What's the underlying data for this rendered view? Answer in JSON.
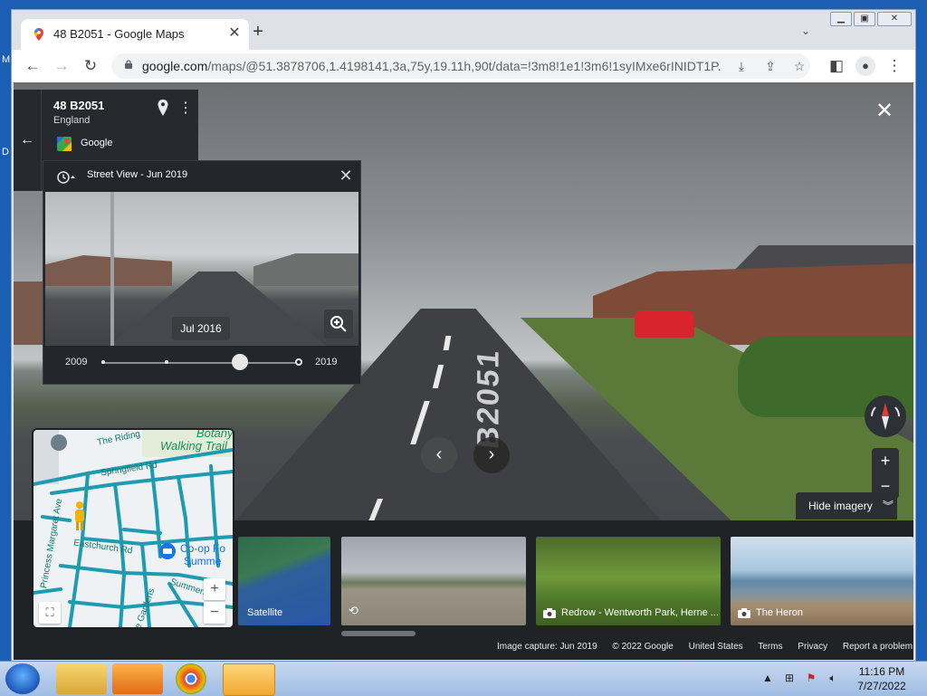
{
  "browser": {
    "tab_title": "48 B2051 - Google Maps",
    "url_host": "google.com",
    "url_path": "/maps/@51.3878706,1.4198141,3a,75y,19.11h,90t/data=!3m8!1e1!3m6!1syIMxe6rINIDT1P..."
  },
  "infocard": {
    "address": "48 B2051",
    "region": "England",
    "provider": "Google"
  },
  "timemachine": {
    "title": "Street View - Jun 2019",
    "preview_date": "Jul 2016",
    "year_min": "2009",
    "year_max": "2019",
    "selected_fraction": 0.7
  },
  "streetview": {
    "road_marking": "B2051",
    "hide_imagery": "Hide imagery"
  },
  "minimap": {
    "labels": {
      "the_riding": "The Riding",
      "botany": "Botany",
      "walking_trail": "Walking Trail",
      "springfield": "Springfield Rd",
      "princess": "Princess Margaret Ave",
      "eastchurch": "Eastchurch Rd",
      "coop": "Co-op Fo",
      "summer": "Summe",
      "summerfield": "Summerfiel",
      "gardens": "e Gardens"
    }
  },
  "strip": {
    "thumbs": [
      {
        "label": "Satellite"
      },
      {
        "label": ""
      },
      {
        "label": "Redrow - Wentworth Park, Herne ..."
      },
      {
        "label": "The Heron"
      }
    ],
    "footer": {
      "capture": "Image capture: Jun 2019",
      "copyright": "© 2022 Google",
      "country": "United States",
      "terms": "Terms",
      "privacy": "Privacy",
      "report": "Report a problem"
    }
  },
  "taskbar": {
    "time": "11:16 PM",
    "date": "7/27/2022"
  },
  "colors": {
    "accent_blue": "#1a73e8",
    "map_road": "#1e9bb0",
    "panel_dark": "#23272b"
  }
}
